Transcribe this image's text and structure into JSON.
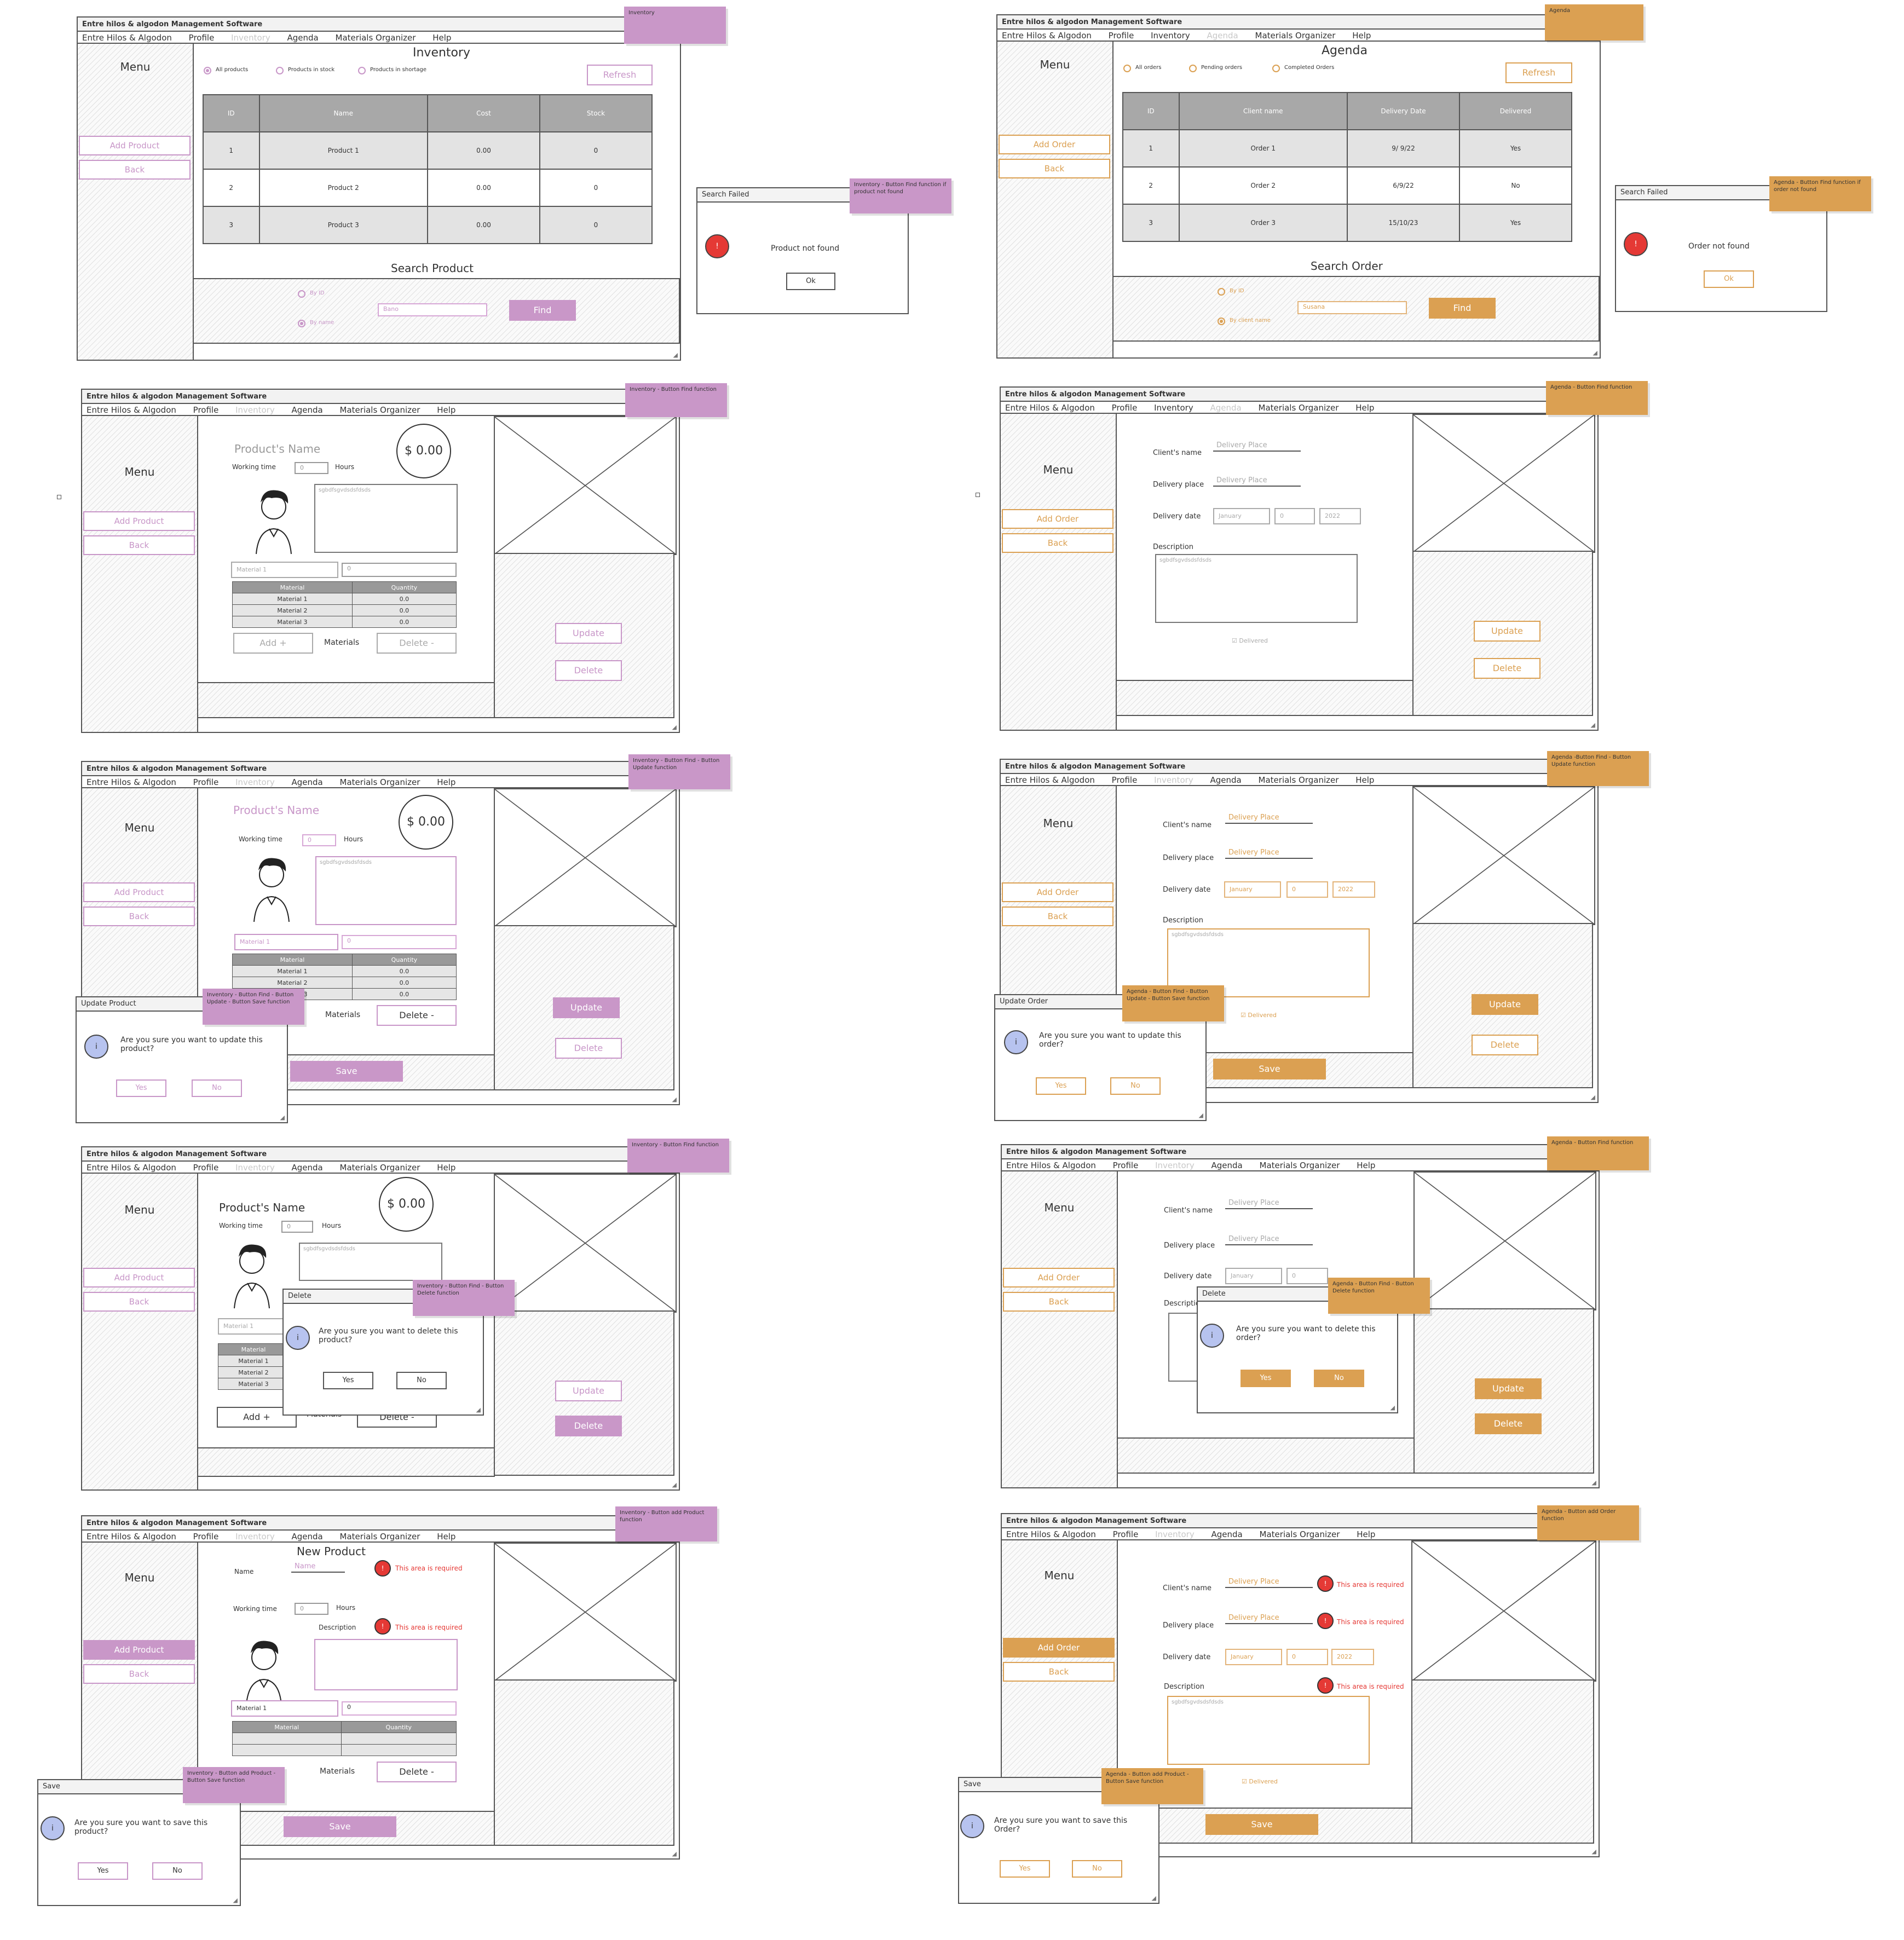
{
  "app_title": "Entre hilos & algodon Management Software",
  "menu": {
    "items": [
      "Entre Hilos & Algodon",
      "Profile",
      "Inventory",
      "Agenda",
      "Materials Organizer",
      "Help"
    ],
    "side_title": "Menu"
  },
  "common": {
    "refresh": "Refresh",
    "find": "Find",
    "update": "Update",
    "delete": "Delete",
    "delete_minus": "Delete -",
    "add_plus": "Add +",
    "materials": "Materials",
    "save": "Save",
    "yes": "Yes",
    "no": "No",
    "ok": "Ok",
    "back": "Back",
    "hours": "Hours",
    "working_time": "Working time",
    "required": "This area is required",
    "textarea_text": "sgbdfsgvdsdsfdsds",
    "delivered": "Delivered",
    "price": "$ 0.00",
    "product_name": "Product's Name"
  },
  "inventory": {
    "title": "Inventory",
    "side_add": "Add Product",
    "filters": [
      "All products",
      "Products in stock",
      "Products in shortage"
    ],
    "columns": [
      "ID",
      "Name",
      "Cost",
      "Stock"
    ],
    "rows": [
      [
        "1",
        "Product 1",
        "0.00",
        "0"
      ],
      [
        "2",
        "Product 2",
        "0.00",
        "0"
      ],
      [
        "3",
        "Product 3",
        "0.00",
        "0"
      ]
    ],
    "search_title": "Search Product",
    "by_id": "By ID",
    "by_name": "By name",
    "search_value": "Bano",
    "search_failed_title": "Search Failed",
    "not_found": "Product not found",
    "material_select": "Material 1",
    "quantity_value": "0",
    "mat_columns": [
      "Material",
      "Quantity"
    ],
    "mat_rows": [
      [
        "Material 1",
        "0.0"
      ],
      [
        "Material 2",
        "0.0"
      ],
      [
        "Material 3",
        "0.0"
      ]
    ],
    "update_title": "Update Product",
    "update_msg": "Are you sure you want to update this product?",
    "delete_title": "Delete",
    "delete_msg": "Are you sure you want to delete this product?",
    "new_product": "New Product",
    "name_label": "Name",
    "name_placeholder": "Name",
    "description_label": "Description",
    "save_title": "Save",
    "save_msg": "Are you sure you want to save this product?",
    "notes": [
      "Inventory",
      "Inventory - Button Find function if product not found",
      "Inventory - Button Find function",
      "Inventory - Button Find - Button Update function",
      "Inventory - Button Find - Button Update - Button Save function",
      "Inventory - Button Find function",
      "Inventory - Button Find - Button Delete function",
      "Inventory - Button add Product function",
      "Inventory - Button add Product - Button Save function"
    ]
  },
  "agenda": {
    "title": "Agenda",
    "side_add": "Add Order",
    "filters": [
      "All orders",
      "Pending orders",
      "Completed Orders"
    ],
    "columns": [
      "ID",
      "Client name",
      "Delivery Date",
      "Delivered"
    ],
    "rows": [
      [
        "1",
        "Order 1",
        "9/ 9/22",
        "Yes"
      ],
      [
        "2",
        "Order 2",
        "6/9/22",
        "No"
      ],
      [
        "3",
        "Order 3",
        "15/10/23",
        "Yes"
      ]
    ],
    "search_title": "Search Order",
    "by_id": "By ID",
    "by_client": "By client name",
    "search_value": "Susana",
    "search_failed_title": "Search Failed",
    "not_found": "Order not found",
    "clients_name": "Client's name",
    "delivery_place": "Delivery place",
    "delivery_date": "Delivery date",
    "description": "Description",
    "placeholder": "Delivery Place",
    "month": "January",
    "day": "0",
    "year": "2022",
    "update_title": "Update Order",
    "update_msg": "Are you sure you want to update this order?",
    "delete_title": "Delete",
    "delete_msg": "Are you sure you want to delete this order?",
    "save_title": "Save",
    "save_msg": "Are you sure you want to save this Order?",
    "notes": [
      "Agenda",
      "Agenda - Button Find function if order not found",
      "Agenda - Button Find function",
      "Agenda -Button Find - Button Update function",
      "Agenda - Button Find - Button Update - Button Save function",
      "Agenda - Button Find function",
      "Agenda - Button Find - Button Delete function",
      "Agenda - Button add Order function",
      "Agenda - Button add Product - Button Save function"
    ]
  },
  "colors": {
    "purple": "#c997c8",
    "orange": "#dba052"
  }
}
